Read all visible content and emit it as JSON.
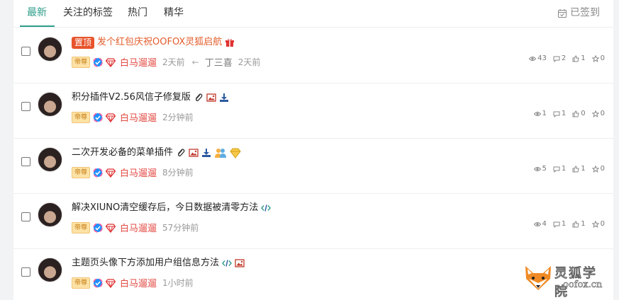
{
  "tabs": [
    {
      "label": "最新"
    },
    {
      "label": "关注的标签"
    },
    {
      "label": "热门"
    },
    {
      "label": "精华"
    }
  ],
  "signin": {
    "label": "已签到"
  },
  "threads": [
    {
      "pin_label": "置顶",
      "title": "发个红包庆祝OOFOX灵狐启航",
      "badge": "帝尊",
      "user": "白马遛遛",
      "time": "2天前",
      "reply_user": "丁三喜",
      "reply_time": "2天前",
      "views": "43",
      "comments": "2",
      "likes": "1",
      "favs": "0"
    },
    {
      "title": "积分插件V2.56风信子修复版",
      "badge": "帝尊",
      "user": "白马遛遛",
      "time": "2分钟前",
      "views": "1",
      "comments": "1",
      "likes": "0",
      "favs": "0"
    },
    {
      "title": "二次开发必备的菜单插件",
      "badge": "帝尊",
      "user": "白马遛遛",
      "time": "8分钟前",
      "views": "5",
      "comments": "1",
      "likes": "1",
      "favs": "0"
    },
    {
      "title": "解决XIUNO清空缓存后，今日数据被清零方法",
      "badge": "帝尊",
      "user": "白马遛遛",
      "time": "57分钟前",
      "views": "4",
      "comments": "1",
      "likes": "1",
      "favs": "0"
    },
    {
      "title": "主题页头像下方添加用户组信息方法",
      "badge": "帝尊",
      "user": "白马遛遛",
      "time": "1小时前"
    }
  ],
  "watermark": {
    "name": "灵狐学院",
    "url": "oofox.cn"
  },
  "colors": {
    "accent": "#2e9e8a",
    "pin": "#e8542b",
    "username": "#e34a43"
  }
}
